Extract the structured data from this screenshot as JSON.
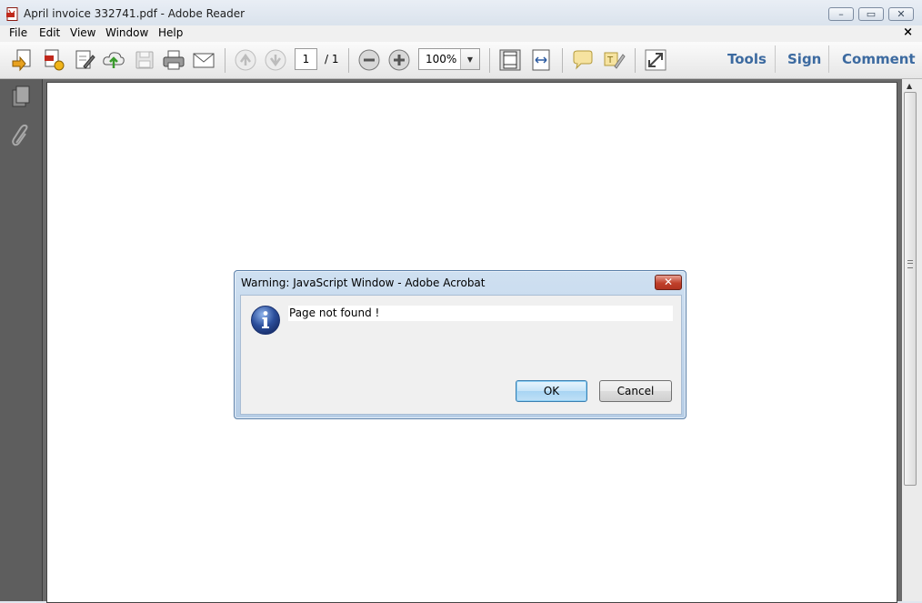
{
  "window": {
    "title": "April invoice 332741.pdf - Adobe Reader",
    "controls": {
      "minimize": "–",
      "restore": "▭",
      "close": "✕"
    }
  },
  "menubar": {
    "items": [
      "File",
      "Edit",
      "View",
      "Window",
      "Help"
    ],
    "close_doc": "×"
  },
  "toolbar": {
    "page_current": "1",
    "page_total": "/ 1",
    "zoom": "100%",
    "zoom_arrow": "▼",
    "panels": [
      "Tools",
      "Sign",
      "Comment"
    ]
  },
  "dialog": {
    "title": "Warning: JavaScript Window - Adobe Acrobat",
    "close": "✕",
    "message": "Page not found !",
    "ok_label": "OK",
    "cancel_label": "Cancel"
  },
  "scrollbar": {
    "up_arrow": "▲"
  },
  "colors": {
    "panel_link": "#3c6aa0",
    "nav_pane": "#5e5e5e",
    "dialog_frame": "#b6cde6",
    "dialog_close": "#c0402b",
    "info_icon": "#2c4f9c"
  },
  "icons": [
    "open-file-icon",
    "create-pdf-icon",
    "edit-icon",
    "upload-cloud-icon",
    "save-icon",
    "print-icon",
    "email-icon",
    "previous-page-icon",
    "next-page-icon",
    "zoom-out-icon",
    "zoom-in-icon",
    "fit-page-icon",
    "fit-width-icon",
    "comment-icon",
    "highlight-icon",
    "fullscreen-icon",
    "pages-icon",
    "attachment-icon",
    "info-icon"
  ]
}
